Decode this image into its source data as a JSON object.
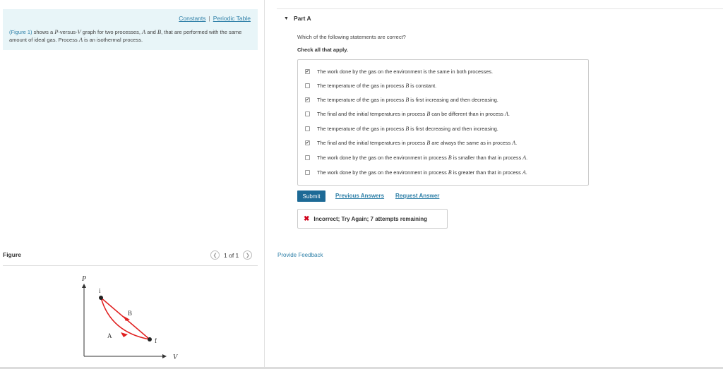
{
  "header_links": {
    "constants": "Constants",
    "separator": "|",
    "periodic": "Periodic Table"
  },
  "intro": {
    "figure_link": "(Figure 1)",
    "text_1": " shows a ",
    "p_var": "P",
    "text_2": "-versus-",
    "v_var": "V",
    "text_3": " graph for two processes, ",
    "a_var": "A",
    "text_4": " and ",
    "b_var": "B",
    "text_5": ", that are performed with the same amount of ideal gas. Process ",
    "a_var2": "A",
    "text_6": " is an isothermal process."
  },
  "figure": {
    "header": "Figure",
    "pager_text": "1 of 1",
    "p_label": "P",
    "v_label": "V",
    "i_label": "i",
    "f_label": "f",
    "a_label": "A",
    "b_label": "B"
  },
  "part": {
    "title": "Part A"
  },
  "question": "Which of the following statements are correct?",
  "check_all": "Check all that apply.",
  "options": [
    {
      "checked": true,
      "t1": "The work done by the gas on the environment is the same in both processes.",
      "v1": "",
      "t2": "",
      "v2": "",
      "t3": ""
    },
    {
      "checked": false,
      "t1": "The temperature of the gas in process ",
      "v1": "B",
      "t2": " is constant.",
      "v2": "",
      "t3": ""
    },
    {
      "checked": true,
      "t1": "The temperature of the gas in process ",
      "v1": "B",
      "t2": " is first increasing and then decreasing.",
      "v2": "",
      "t3": ""
    },
    {
      "checked": false,
      "t1": "The final and the initial temperatures in process ",
      "v1": "B",
      "t2": " can be different than in process ",
      "v2": "A",
      "t3": "."
    },
    {
      "checked": false,
      "t1": "The temperature of the gas in process ",
      "v1": "B",
      "t2": " is first decreasing and then increasing.",
      "v2": "",
      "t3": ""
    },
    {
      "checked": true,
      "t1": "The final and the initial temperatures in process ",
      "v1": "B",
      "t2": " are always the same as in process ",
      "v2": "A",
      "t3": "."
    },
    {
      "checked": false,
      "t1": "The work done by the gas on the environment in process ",
      "v1": "B",
      "t2": " is smaller than that in process ",
      "v2": "A",
      "t3": "."
    },
    {
      "checked": false,
      "t1": "The work done by the gas on the environment in process ",
      "v1": "B",
      "t2": " is greater than that in process ",
      "v2": "A",
      "t3": "."
    }
  ],
  "check_mark": "✔",
  "buttons": {
    "submit": "Submit",
    "previous": "Previous Answers",
    "request": "Request Answer"
  },
  "feedback": {
    "icon": "✖",
    "text": "Incorrect; Try Again; 7 attempts remaining"
  },
  "provide_feedback": "Provide Feedback",
  "colors": {
    "accent": "#2f80a8",
    "submit_bg": "#1d6a96",
    "curve": "#e02020",
    "error": "#d0021b"
  }
}
